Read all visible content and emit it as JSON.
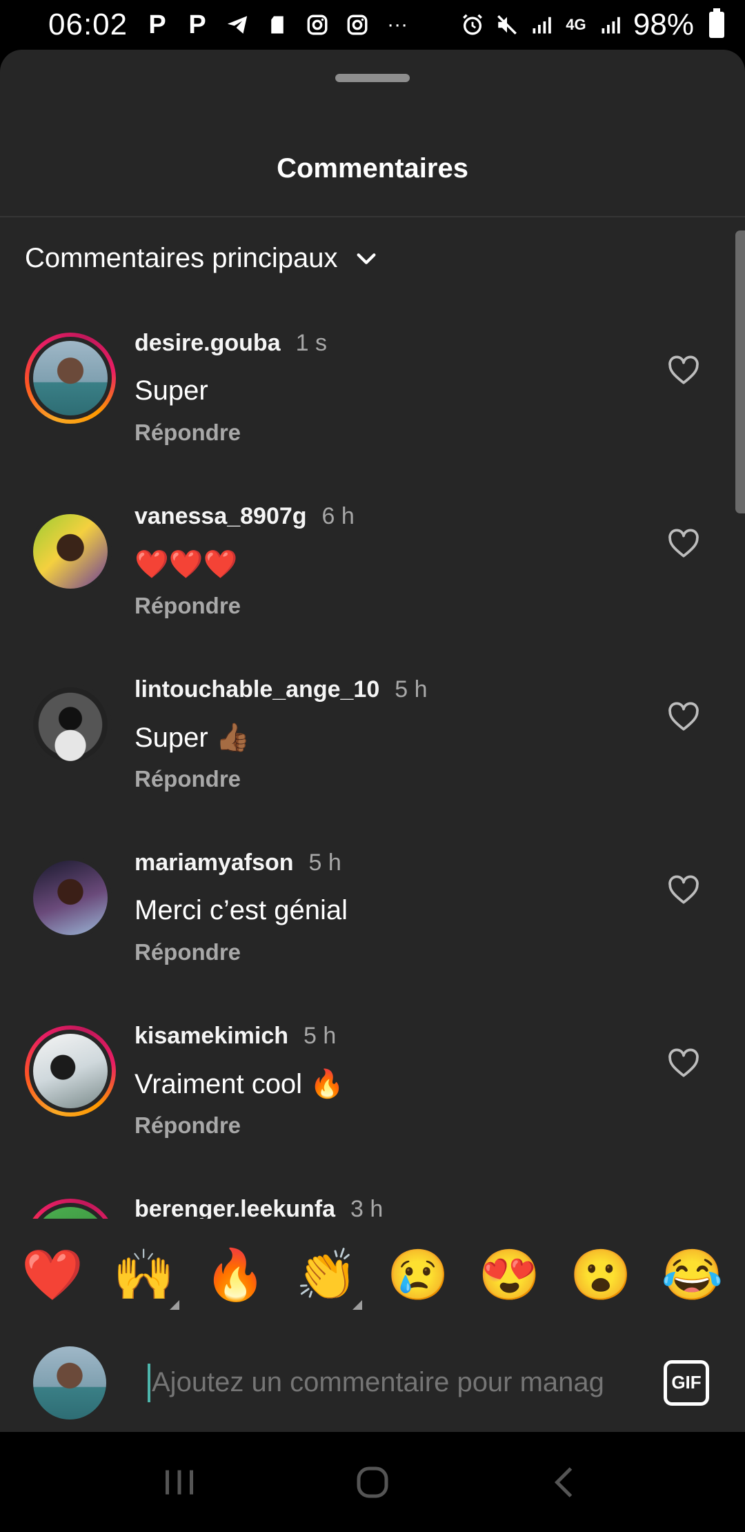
{
  "status_bar": {
    "time": "06:02",
    "battery": "98%",
    "icons": [
      "p-icon",
      "p-icon",
      "telegram-icon",
      "sd-card-icon",
      "instagram-icon",
      "instagram-icon",
      "more-icon",
      "alarm-icon",
      "mute-icon",
      "signal-icon",
      "4g-lte-icon",
      "signal-icon",
      "battery-icon"
    ],
    "network_label": "4G"
  },
  "sheet": {
    "title": "Commentaires",
    "sort_label": "Commentaires principaux"
  },
  "comments": [
    {
      "user": "desire.gouba",
      "time": "1 s",
      "text": "Super",
      "reply": "Répondre",
      "story": true
    },
    {
      "user": "vanessa_8907g",
      "time": "6 h",
      "text": "❤️❤️❤️",
      "reply": "Répondre",
      "story": false
    },
    {
      "user": "lintouchable_ange_10",
      "time": "5 h",
      "text": "Super 👍🏾",
      "reply": "Répondre",
      "story": false
    },
    {
      "user": "mariamyafson",
      "time": "5 h",
      "text": "Merci c’est génial",
      "reply": "Répondre",
      "story": false
    },
    {
      "user": "kisamekimich",
      "time": "5 h",
      "text": "Vraiment cool 🔥",
      "reply": "Répondre",
      "story": true
    },
    {
      "user": "berenger.leekunfa",
      "time": "3 h",
      "text": "",
      "reply": "",
      "story": true
    }
  ],
  "emoji_bar": [
    "❤️",
    "🙌",
    "🔥",
    "👏",
    "😢",
    "😍",
    "😮",
    "😂"
  ],
  "composer": {
    "placeholder": "Ajoutez un commentaire pour manag",
    "gif_label": "GIF"
  },
  "colors": {
    "sheet_bg": "#262626",
    "secondary_text": "#a8a8a8",
    "caret": "#4db6ac"
  }
}
